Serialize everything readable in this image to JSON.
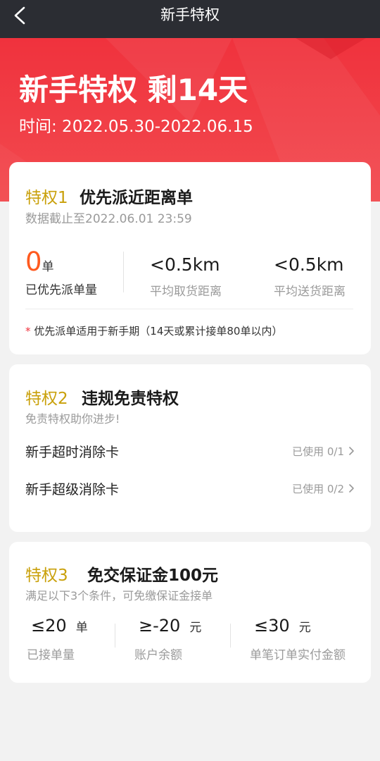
{
  "nav": {
    "title": "新手特权",
    "back_icon": "chevron-left-icon"
  },
  "hero": {
    "title": "新手特权 剩14天",
    "period": "时间: 2022.05.30-2022.06.15"
  },
  "card1": {
    "num": "特权1",
    "name": "优先派近距离单",
    "cutoff": "数据截止至2022.06.01 23:59",
    "stats": [
      {
        "value": "0",
        "unit": "单",
        "label": "已优先派单量"
      },
      {
        "value": "<0.5km",
        "label": "平均取货距离"
      },
      {
        "value": "<0.5km",
        "label": "平均送货距离"
      }
    ],
    "note_mark": "*",
    "note": "优先派单适用于新手期（14天或累计接单80单以内）"
  },
  "card2": {
    "num": "特权2",
    "name": "违规免责特权",
    "subtitle": "免责特权助你进步!",
    "items": [
      {
        "label": "新手超时消除卡",
        "status": "已使用 0/1"
      },
      {
        "label": "新手超级消除卡",
        "status": "已使用 0/2"
      }
    ]
  },
  "card3": {
    "num": "特权3",
    "name": "免交保证金100元",
    "subtitle": "满足以下3个条件，可免缴保证金接单",
    "conditions": [
      {
        "value": "≤20",
        "unit": "单",
        "label": "已接单量"
      },
      {
        "value": "≥-20",
        "unit": "元",
        "label": "账户余额"
      },
      {
        "value": "≤30",
        "unit": "元",
        "label": "单笔订单实付金额"
      }
    ]
  },
  "colors": {
    "accent_red": "#f0323d",
    "gold": "#c9a00a",
    "orange": "#ff5a1f",
    "topbar": "#2b2d33"
  }
}
